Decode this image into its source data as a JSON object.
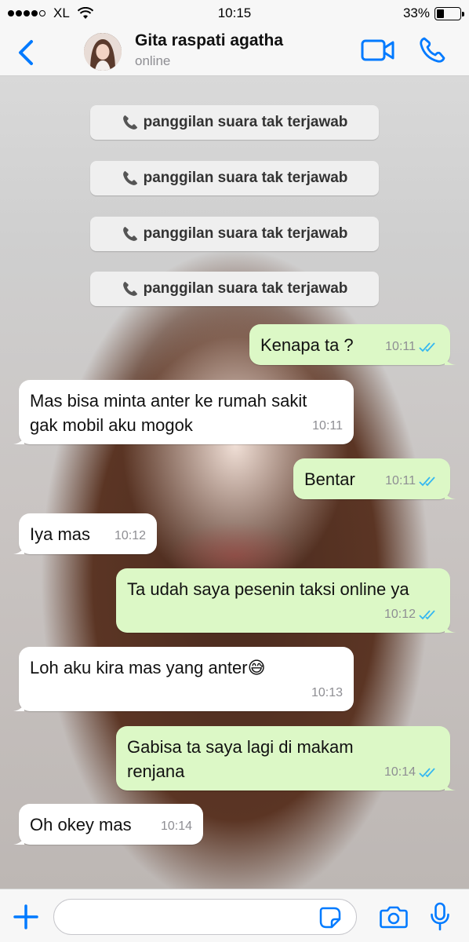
{
  "status_bar": {
    "carrier": "XL",
    "time": "10:15",
    "battery_text": "33%",
    "battery_level": 0.33,
    "signal_bars_filled": 4,
    "signal_bars_total": 5
  },
  "header": {
    "contact_name": "Gita raspati agatha",
    "contact_status": "online",
    "icons": [
      "back-chevron-icon",
      "avatar",
      "video-call-icon",
      "voice-call-icon"
    ]
  },
  "call_notices": [
    {
      "label": "panggilan suara tak terjawab",
      "icon": "phone-icon"
    },
    {
      "label": "panggilan suara tak terjawab",
      "icon": "phone-icon"
    },
    {
      "label": "panggilan suara tak terjawab",
      "icon": "phone-icon"
    },
    {
      "label": "panggilan suara tak terjawab",
      "icon": "phone-icon"
    }
  ],
  "messages": [
    {
      "direction": "out",
      "text": "Kenapa ta ?",
      "time": "10:11",
      "read": true
    },
    {
      "direction": "in",
      "text": "Mas bisa minta anter ke rumah sakit\ngak mobil aku mogok",
      "time": "10:11"
    },
    {
      "direction": "out",
      "text": "Bentar",
      "time": "10:11",
      "read": true
    },
    {
      "direction": "in",
      "text": "Iya mas",
      "time": "10:12"
    },
    {
      "direction": "out",
      "text": "Ta udah saya pesenin taksi online ya",
      "time": "10:12",
      "read": true
    },
    {
      "direction": "in",
      "text": "Loh aku kira mas yang anter😅",
      "time": "10:13"
    },
    {
      "direction": "out",
      "text": "Gabisa ta saya lagi di makam\nrenjana",
      "time": "10:14",
      "read": true
    },
    {
      "direction": "in",
      "text": "Oh okey mas",
      "time": "10:14"
    }
  ],
  "input_bar": {
    "placeholder": "",
    "value": "",
    "icons": [
      "plus-icon",
      "sticker-icon",
      "camera-icon",
      "microphone-icon"
    ]
  },
  "colors": {
    "accent": "#007aff",
    "outgoing_bubble": "#dcf8c6",
    "incoming_bubble": "#ffffff",
    "read_ticks": "#34b7f1",
    "timestamp": "#8e8e93"
  }
}
